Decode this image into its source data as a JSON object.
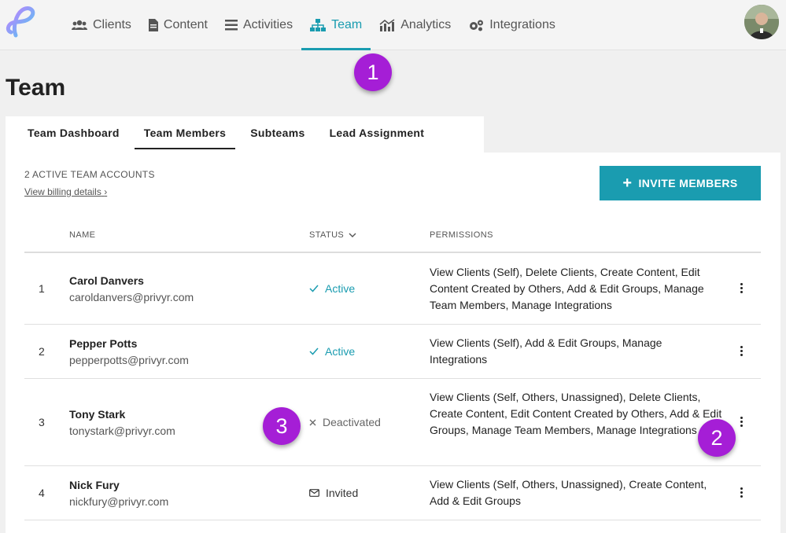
{
  "nav": {
    "items": [
      {
        "label": "Clients",
        "icon": "users-icon"
      },
      {
        "label": "Content",
        "icon": "document-icon"
      },
      {
        "label": "Activities",
        "icon": "list-icon"
      },
      {
        "label": "Team",
        "icon": "org-chart-icon",
        "active": true
      },
      {
        "label": "Analytics",
        "icon": "chart-icon"
      },
      {
        "label": "Integrations",
        "icon": "gears-icon"
      }
    ]
  },
  "page": {
    "title": "Team"
  },
  "tabs": [
    {
      "label": "Team Dashboard"
    },
    {
      "label": "Team Members",
      "active": true
    },
    {
      "label": "Subteams"
    },
    {
      "label": "Lead Assignment"
    }
  ],
  "summary": {
    "accounts": "2 ACTIVE TEAM ACCOUNTS",
    "billing_link": "View billing details"
  },
  "invite_button": {
    "plus": "+",
    "label": "INVITE MEMBERS"
  },
  "table": {
    "headers": {
      "name": "NAME",
      "status": "STATUS",
      "permissions": "PERMISSIONS"
    },
    "rows": [
      {
        "num": "1",
        "name": "Carol Danvers",
        "email": "caroldanvers@privyr.com",
        "status": "Active",
        "permissions": "View Clients (Self), Delete Clients, Create Content, Edit Content Created by Others, Add & Edit Groups, Manage Team Members, Manage Integrations"
      },
      {
        "num": "2",
        "name": "Pepper Potts",
        "email": "pepperpotts@privyr.com",
        "status": "Active",
        "permissions": "View Clients (Self), Add & Edit Groups, Manage Integrations"
      },
      {
        "num": "3",
        "name": "Tony Stark",
        "email": "tonystark@privyr.com",
        "status": "Deactivated",
        "permissions": "View Clients (Self, Others, Unassigned), Delete Clients, Create Content, Edit Content Created by Others, Add & Edit Groups, Manage Team Members, Manage Integrations"
      },
      {
        "num": "4",
        "name": "Nick Fury",
        "email": "nickfury@privyr.com",
        "status": "Invited",
        "permissions": "View Clients (Self, Others, Unassigned), Create Content, Add & Edit Groups"
      }
    ]
  },
  "markers": [
    "1",
    "2",
    "3"
  ],
  "colors": {
    "accent": "#1a9cb0",
    "marker": "#a51ed6"
  }
}
